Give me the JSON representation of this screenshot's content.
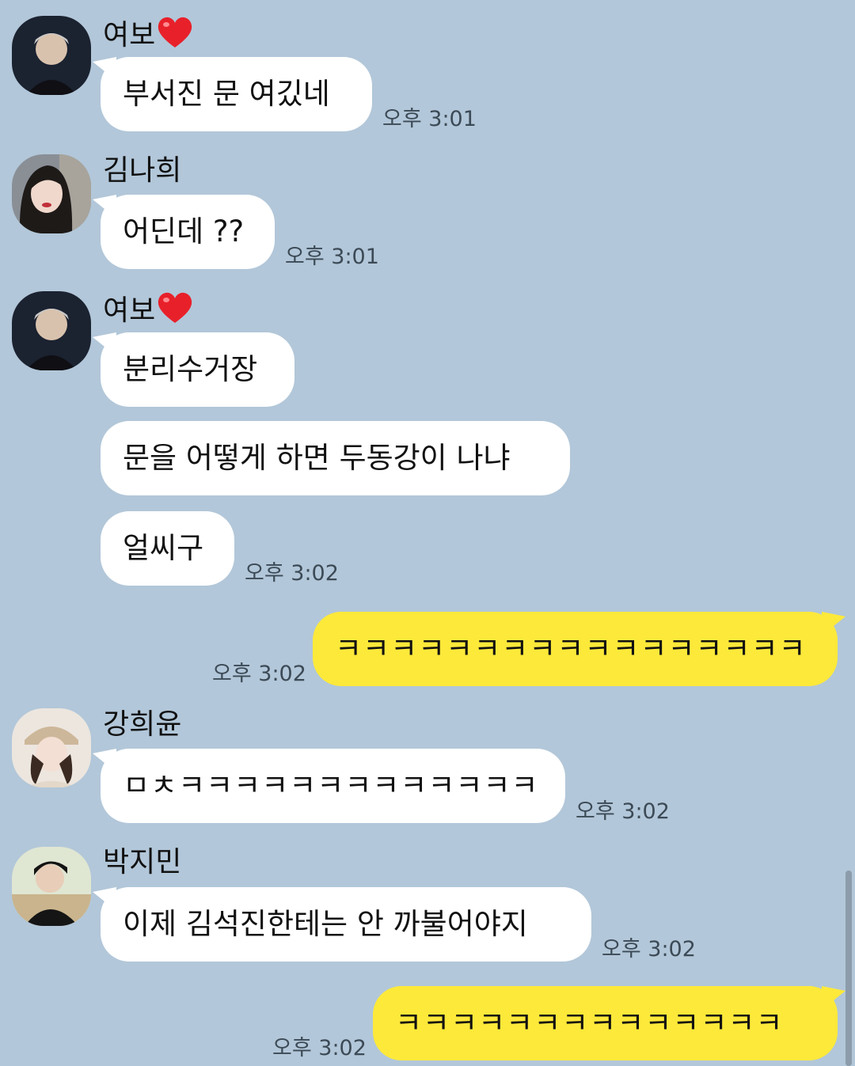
{
  "messages": {
    "m1": {
      "sender": "여보",
      "text": "부서진 문 여깄네",
      "time": "오후 3:01"
    },
    "m2": {
      "sender": "김나희",
      "text": "어딘데 ??",
      "time": "오후 3:01"
    },
    "m3": {
      "sender": "여보",
      "text": "분리수거장"
    },
    "m4": {
      "text": "문을 어떻게 하면 두동강이 나냐"
    },
    "m5": {
      "text": "얼씨구",
      "time": "오후 3:02"
    },
    "m6": {
      "text": "ㅋㅋㅋㅋㅋㅋㅋㅋㅋㅋㅋㅋㅋㅋㅋㅋㅋ",
      "time": "오후 3:02"
    },
    "m7": {
      "sender": "강희윤",
      "text": "ㅁㅊㅋㅋㅋㅋㅋㅋㅋㅋㅋㅋㅋㅋㅋ",
      "time": "오후 3:02"
    },
    "m8": {
      "sender": "박지민",
      "text": "이제 김석진한테는 안 까불어야지",
      "time": "오후 3:02"
    },
    "m9": {
      "text": "ㅋㅋㅋㅋㅋㅋㅋㅋㅋㅋㅋㅋㅋㅋ",
      "time": "오후 3:02"
    }
  },
  "colors": {
    "background": "#b2c7d9",
    "incoming_bubble": "#ffffff",
    "outgoing_bubble": "#fde93a",
    "heart": "#e8202a"
  },
  "icons": {
    "heart": "red-heart-emoji",
    "avatar": "profile-photo"
  }
}
